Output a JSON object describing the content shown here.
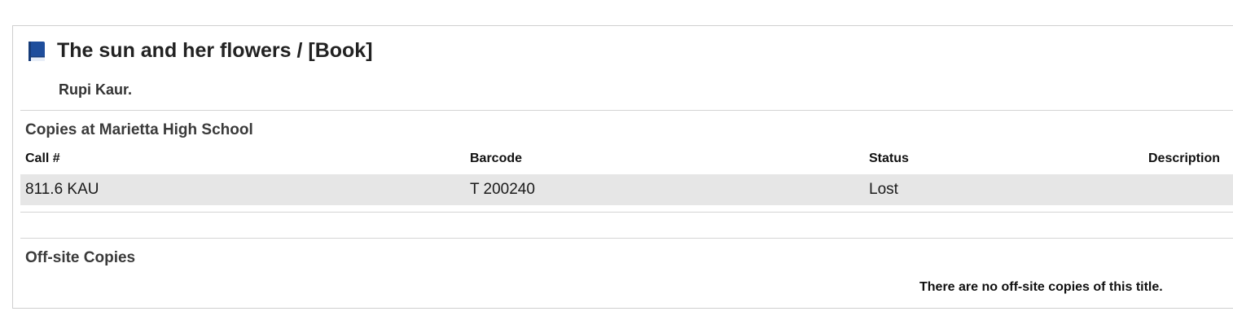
{
  "title": {
    "text": "The sun and her flowers / [Book]",
    "icon": "book-icon"
  },
  "author": "Rupi Kaur.",
  "copies_section": {
    "heading": "Copies at Marietta High School",
    "columns": {
      "call": "Call #",
      "barcode": "Barcode",
      "status": "Status",
      "description": "Description"
    },
    "rows": [
      {
        "call": "811.6 KAU",
        "barcode": "T 200240",
        "status": "Lost",
        "description": ""
      }
    ]
  },
  "offsite_section": {
    "heading": "Off-site Copies",
    "message": "There are no off-site copies of this title."
  },
  "colors": {
    "icon_blue": "#1f4e9c",
    "row_background": "#e6e6e6",
    "divider": "#d4d4d4"
  }
}
